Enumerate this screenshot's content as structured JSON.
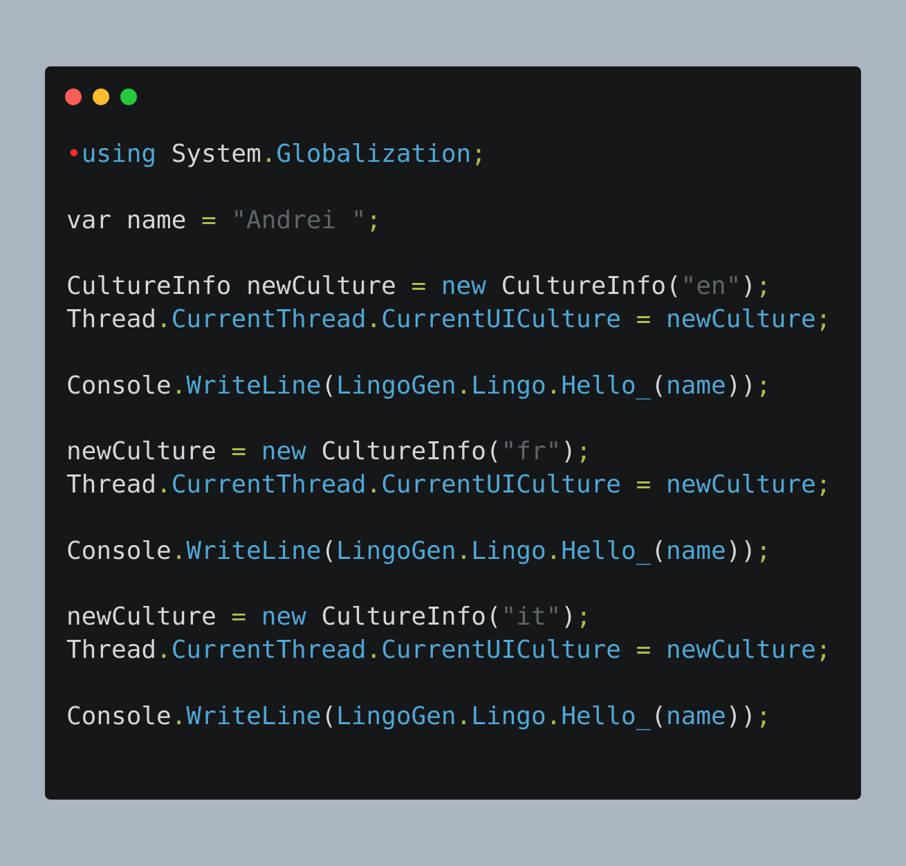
{
  "window": {
    "controls": [
      {
        "name": "close-button",
        "color": "#ff5f56"
      },
      {
        "name": "minimize-button",
        "color": "#ffbd2e"
      },
      {
        "name": "maximize-button",
        "color": "#27c93f"
      }
    ]
  },
  "code": {
    "lines": [
      [
        {
          "t": "•",
          "k": "marker"
        },
        {
          "t": "using",
          "k": "kw"
        },
        {
          "t": " System",
          "k": "id"
        },
        {
          "t": ".",
          "k": "op"
        },
        {
          "t": "Globalization",
          "k": "mem"
        },
        {
          "t": ";",
          "k": "op"
        }
      ],
      [],
      [
        {
          "t": "var name ",
          "k": "id"
        },
        {
          "t": "=",
          "k": "op"
        },
        {
          "t": " ",
          "k": "id"
        },
        {
          "t": "\"Andrei \"",
          "k": "str"
        },
        {
          "t": ";",
          "k": "op"
        }
      ],
      [],
      [
        {
          "t": "CultureInfo newCulture ",
          "k": "id"
        },
        {
          "t": "=",
          "k": "op"
        },
        {
          "t": " ",
          "k": "id"
        },
        {
          "t": "new",
          "k": "kw"
        },
        {
          "t": " CultureInfo(",
          "k": "id"
        },
        {
          "t": "\"en\"",
          "k": "str"
        },
        {
          "t": ")",
          "k": "id"
        },
        {
          "t": ";",
          "k": "op"
        }
      ],
      [
        {
          "t": "Thread",
          "k": "id"
        },
        {
          "t": ".",
          "k": "op"
        },
        {
          "t": "CurrentThread",
          "k": "mem"
        },
        {
          "t": ".",
          "k": "op"
        },
        {
          "t": "CurrentUICulture ",
          "k": "mem"
        },
        {
          "t": "=",
          "k": "op"
        },
        {
          "t": " newCulture",
          "k": "mem"
        },
        {
          "t": ";",
          "k": "op"
        }
      ],
      [],
      [
        {
          "t": "Console",
          "k": "id"
        },
        {
          "t": ".",
          "k": "op"
        },
        {
          "t": "WriteLine",
          "k": "mem"
        },
        {
          "t": "(",
          "k": "pn"
        },
        {
          "t": "LingoGen",
          "k": "mem"
        },
        {
          "t": ".",
          "k": "op"
        },
        {
          "t": "Lingo",
          "k": "mem"
        },
        {
          "t": ".",
          "k": "op"
        },
        {
          "t": "Hello_",
          "k": "mem"
        },
        {
          "t": "(",
          "k": "pn"
        },
        {
          "t": "name",
          "k": "mem"
        },
        {
          "t": "))",
          "k": "pn"
        },
        {
          "t": ";",
          "k": "op"
        }
      ],
      [],
      [
        {
          "t": "newCulture ",
          "k": "id"
        },
        {
          "t": "=",
          "k": "op"
        },
        {
          "t": " ",
          "k": "id"
        },
        {
          "t": "new",
          "k": "kw"
        },
        {
          "t": " CultureInfo(",
          "k": "id"
        },
        {
          "t": "\"fr\"",
          "k": "str"
        },
        {
          "t": ")",
          "k": "id"
        },
        {
          "t": ";",
          "k": "op"
        }
      ],
      [
        {
          "t": "Thread",
          "k": "id"
        },
        {
          "t": ".",
          "k": "op"
        },
        {
          "t": "CurrentThread",
          "k": "mem"
        },
        {
          "t": ".",
          "k": "op"
        },
        {
          "t": "CurrentUICulture ",
          "k": "mem"
        },
        {
          "t": "=",
          "k": "op"
        },
        {
          "t": " newCulture",
          "k": "mem"
        },
        {
          "t": ";",
          "k": "op"
        }
      ],
      [],
      [
        {
          "t": "Console",
          "k": "id"
        },
        {
          "t": ".",
          "k": "op"
        },
        {
          "t": "WriteLine",
          "k": "mem"
        },
        {
          "t": "(",
          "k": "pn"
        },
        {
          "t": "LingoGen",
          "k": "mem"
        },
        {
          "t": ".",
          "k": "op"
        },
        {
          "t": "Lingo",
          "k": "mem"
        },
        {
          "t": ".",
          "k": "op"
        },
        {
          "t": "Hello_",
          "k": "mem"
        },
        {
          "t": "(",
          "k": "pn"
        },
        {
          "t": "name",
          "k": "mem"
        },
        {
          "t": "))",
          "k": "pn"
        },
        {
          "t": ";",
          "k": "op"
        }
      ],
      [],
      [
        {
          "t": "newCulture ",
          "k": "id"
        },
        {
          "t": "=",
          "k": "op"
        },
        {
          "t": " ",
          "k": "id"
        },
        {
          "t": "new",
          "k": "kw"
        },
        {
          "t": " CultureInfo(",
          "k": "id"
        },
        {
          "t": "\"it\"",
          "k": "str"
        },
        {
          "t": ")",
          "k": "id"
        },
        {
          "t": ";",
          "k": "op"
        }
      ],
      [
        {
          "t": "Thread",
          "k": "id"
        },
        {
          "t": ".",
          "k": "op"
        },
        {
          "t": "CurrentThread",
          "k": "mem"
        },
        {
          "t": ".",
          "k": "op"
        },
        {
          "t": "CurrentUICulture ",
          "k": "mem"
        },
        {
          "t": "=",
          "k": "op"
        },
        {
          "t": " newCulture",
          "k": "mem"
        },
        {
          "t": ";",
          "k": "op"
        }
      ],
      [],
      [
        {
          "t": "Console",
          "k": "id"
        },
        {
          "t": ".",
          "k": "op"
        },
        {
          "t": "WriteLine",
          "k": "mem"
        },
        {
          "t": "(",
          "k": "pn"
        },
        {
          "t": "LingoGen",
          "k": "mem"
        },
        {
          "t": ".",
          "k": "op"
        },
        {
          "t": "Lingo",
          "k": "mem"
        },
        {
          "t": ".",
          "k": "op"
        },
        {
          "t": "Hello_",
          "k": "mem"
        },
        {
          "t": "(",
          "k": "pn"
        },
        {
          "t": "name",
          "k": "mem"
        },
        {
          "t": "))",
          "k": "pn"
        },
        {
          "t": ";",
          "k": "op"
        }
      ]
    ]
  }
}
